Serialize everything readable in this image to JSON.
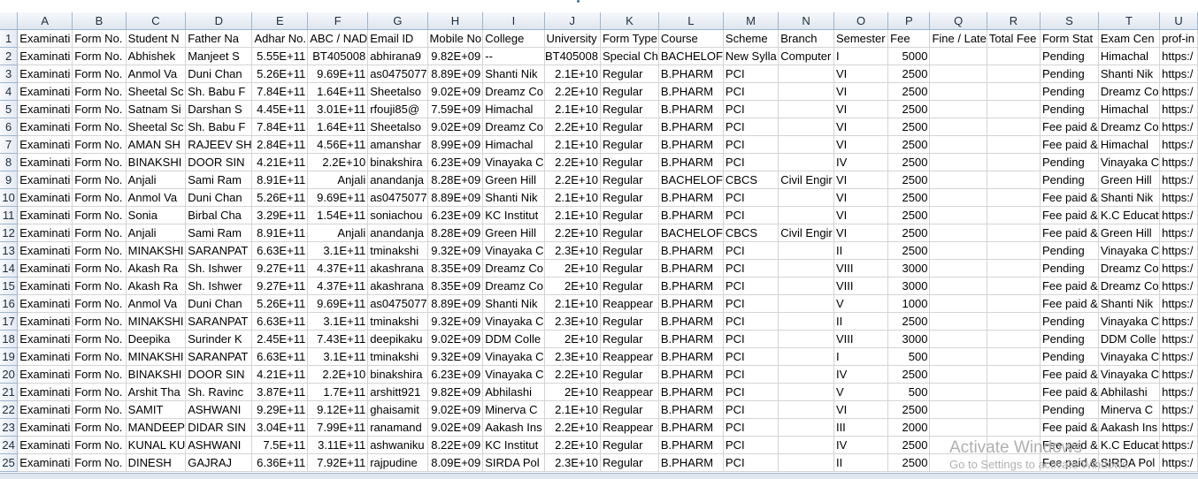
{
  "columns": [
    "A",
    "B",
    "C",
    "D",
    "E",
    "F",
    "G",
    "H",
    "I",
    "J",
    "K",
    "L",
    "M",
    "N",
    "O",
    "P",
    "Q",
    "R",
    "S",
    "T",
    "U"
  ],
  "numeric_columns": [
    4,
    5,
    7,
    9,
    15
  ],
  "rows": [
    [
      "Examinati",
      "Form No.",
      "Student N",
      "Father Na",
      "Adhar No.",
      "ABC / NAD",
      "Email ID",
      "Mobile No",
      "College",
      "University",
      "Form Type",
      "Course",
      "Scheme",
      "Branch",
      "Semester",
      "Fee",
      "Fine / Late",
      "Total Fee",
      "Form Stat",
      "Exam Cen",
      "prof-in"
    ],
    [
      "Examinati",
      "Form No.",
      "Abhishek",
      "Manjeet S",
      "5.55E+11",
      "BT405008",
      "abhirana9",
      "9.82E+09",
      "--",
      "BT405008",
      "Special Ch",
      "BACHELOF",
      "New Sylla",
      "Computer",
      "I",
      "5000",
      "",
      "",
      "Pending",
      "Himachal",
      "https:/"
    ],
    [
      "Examinati",
      "Form No.",
      "Anmol Va",
      "Duni Chan",
      "5.26E+11",
      "9.69E+11",
      "as0475077",
      "8.89E+09",
      "Shanti Nik",
      "2.1E+10",
      "Regular",
      "B.PHARM",
      "PCI",
      "",
      "VI",
      "2500",
      "",
      "",
      "Pending",
      "Shanti Nik",
      "https:/"
    ],
    [
      "Examinati",
      "Form No.",
      "Sheetal Sc",
      "Sh. Babu F",
      "7.84E+11",
      "1.64E+11",
      "Sheetalso",
      "9.02E+09",
      "Dreamz Co",
      "2.2E+10",
      "Regular",
      "B.PHARM",
      "PCI",
      "",
      "VI",
      "2500",
      "",
      "",
      "Pending",
      "Dreamz Co",
      "https:/"
    ],
    [
      "Examinati",
      "Form No.",
      "Satnam Si",
      "Darshan S",
      "4.45E+11",
      "3.01E+11",
      "rfouji85@",
      "7.59E+09",
      "Himachal",
      "2.1E+10",
      "Regular",
      "B.PHARM",
      "PCI",
      "",
      "VI",
      "2500",
      "",
      "",
      "Pending",
      "Himachal",
      "https:/"
    ],
    [
      "Examinati",
      "Form No.",
      "Sheetal Sc",
      "Sh. Babu F",
      "7.84E+11",
      "1.64E+11",
      "Sheetalso",
      "9.02E+09",
      "Dreamz Co",
      "2.2E+10",
      "Regular",
      "B.PHARM",
      "PCI",
      "",
      "VI",
      "2500",
      "",
      "",
      "Fee paid &",
      "Dreamz Co",
      "https:/"
    ],
    [
      "Examinati",
      "Form No.",
      "AMAN SH",
      "RAJEEV SH",
      "2.84E+11",
      "4.56E+11",
      "amanshar",
      "8.99E+09",
      "Himachal",
      "2.1E+10",
      "Regular",
      "B.PHARM",
      "PCI",
      "",
      "VI",
      "2500",
      "",
      "",
      "Fee paid &",
      "Himachal",
      "https:/"
    ],
    [
      "Examinati",
      "Form No.",
      "BINAKSHI",
      "DOOR SIN",
      "4.21E+11",
      "2.2E+10",
      "binakshira",
      "6.23E+09",
      "Vinayaka C",
      "2.2E+10",
      "Regular",
      "B.PHARM",
      "PCI",
      "",
      "IV",
      "2500",
      "",
      "",
      "Pending",
      "Vinayaka C",
      "https:/"
    ],
    [
      "Examinati",
      "Form No.",
      "Anjali",
      "Sami Ram",
      "8.91E+11",
      "Anjali",
      "anandanja",
      "8.28E+09",
      "Green Hill",
      "2.2E+10",
      "Regular",
      "BACHELOF",
      "CBCS",
      "Civil Engir",
      "VI",
      "2500",
      "",
      "",
      "Pending",
      "Green Hill",
      "https:/"
    ],
    [
      "Examinati",
      "Form No.",
      "Anmol Va",
      "Duni Chan",
      "5.26E+11",
      "9.69E+11",
      "as0475077",
      "8.89E+09",
      "Shanti Nik",
      "2.1E+10",
      "Regular",
      "B.PHARM",
      "PCI",
      "",
      "VI",
      "2500",
      "",
      "",
      "Fee paid &",
      "Shanti Nik",
      "https:/"
    ],
    [
      "Examinati",
      "Form No.",
      "Sonia",
      "Birbal Cha",
      "3.29E+11",
      "1.54E+11",
      "soniachou",
      "6.23E+09",
      "KC Institut",
      "2.1E+10",
      "Regular",
      "B.PHARM",
      "PCI",
      "",
      "VI",
      "2500",
      "",
      "",
      "Fee paid &",
      "K.C Educat",
      "https:/"
    ],
    [
      "Examinati",
      "Form No.",
      "Anjali",
      "Sami Ram",
      "8.91E+11",
      "Anjali",
      "anandanja",
      "8.28E+09",
      "Green Hill",
      "2.2E+10",
      "Regular",
      "BACHELOF",
      "CBCS",
      "Civil Engir",
      "VI",
      "2500",
      "",
      "",
      "Fee paid &",
      "Green Hill",
      "https:/"
    ],
    [
      "Examinati",
      "Form No.",
      "MINAKSHI",
      "SARANPAT",
      "6.63E+11",
      "3.1E+11",
      "tminakshi",
      "9.32E+09",
      "Vinayaka C",
      "2.3E+10",
      "Regular",
      "B.PHARM",
      "PCI",
      "",
      "II",
      "2500",
      "",
      "",
      "Pending",
      "Vinayaka C",
      "https:/"
    ],
    [
      "Examinati",
      "Form No.",
      "Akash Ra",
      "Sh. Ishwer",
      "9.27E+11",
      "4.37E+11",
      "akashrana",
      "8.35E+09",
      "Dreamz Co",
      "2E+10",
      "Regular",
      "B.PHARM",
      "PCI",
      "",
      "VIII",
      "3000",
      "",
      "",
      "Pending",
      "Dreamz Co",
      "https:/"
    ],
    [
      "Examinati",
      "Form No.",
      "Akash Ra",
      "Sh. Ishwer",
      "9.27E+11",
      "4.37E+11",
      "akashrana",
      "8.35E+09",
      "Dreamz Co",
      "2E+10",
      "Regular",
      "B.PHARM",
      "PCI",
      "",
      "VIII",
      "3000",
      "",
      "",
      "Fee paid &",
      "Dreamz Co",
      "https:/"
    ],
    [
      "Examinati",
      "Form No.",
      "Anmol Va",
      "Duni Chan",
      "5.26E+11",
      "9.69E+11",
      "as0475077",
      "8.89E+09",
      "Shanti Nik",
      "2.1E+10",
      "Reappear",
      "B.PHARM",
      "PCI",
      "",
      "V",
      "1000",
      "",
      "",
      "Fee paid &",
      "Shanti Nik",
      "https:/"
    ],
    [
      "Examinati",
      "Form No.",
      "MINAKSHI",
      "SARANPAT",
      "6.63E+11",
      "3.1E+11",
      "tminakshi",
      "9.32E+09",
      "Vinayaka C",
      "2.3E+10",
      "Regular",
      "B.PHARM",
      "PCI",
      "",
      "II",
      "2500",
      "",
      "",
      "Pending",
      "Vinayaka C",
      "https:/"
    ],
    [
      "Examinati",
      "Form No.",
      "Deepika",
      "Surinder K",
      "2.45E+11",
      "7.43E+11",
      "deepikaku",
      "9.02E+09",
      "DDM Colle",
      "2E+10",
      "Regular",
      "B.PHARM",
      "PCI",
      "",
      "VIII",
      "3000",
      "",
      "",
      "Pending",
      "DDM Colle",
      "https:/"
    ],
    [
      "Examinati",
      "Form No.",
      "MINAKSHI",
      "SARANPAT",
      "6.63E+11",
      "3.1E+11",
      "tminakshi",
      "9.32E+09",
      "Vinayaka C",
      "2.3E+10",
      "Reappear",
      "B.PHARM",
      "PCI",
      "",
      "I",
      "500",
      "",
      "",
      "Pending",
      "Vinayaka C",
      "https:/"
    ],
    [
      "Examinati",
      "Form No.",
      "BINAKSHI",
      "DOOR SIN",
      "4.21E+11",
      "2.2E+10",
      "binakshira",
      "6.23E+09",
      "Vinayaka C",
      "2.2E+10",
      "Regular",
      "B.PHARM",
      "PCI",
      "",
      "IV",
      "2500",
      "",
      "",
      "Fee paid &",
      "Vinayaka C",
      "https:/"
    ],
    [
      "Examinati",
      "Form No.",
      "Arshit Tha",
      "Sh. Ravinc",
      "3.87E+11",
      "1.7E+11",
      "arshitt921",
      "9.82E+09",
      "Abhilashi",
      "2E+10",
      "Reappear",
      "B.PHARM",
      "PCI",
      "",
      "V",
      "500",
      "",
      "",
      "Fee paid &",
      "Abhilashi",
      "https:/"
    ],
    [
      "Examinati",
      "Form No.",
      "SAMIT",
      "ASHWANI",
      "9.29E+11",
      "9.12E+11",
      "ghaisamit",
      "9.02E+09",
      "Minerva C",
      "2.1E+10",
      "Regular",
      "B.PHARM",
      "PCI",
      "",
      "VI",
      "2500",
      "",
      "",
      "Pending",
      "Minerva C",
      "https:/"
    ],
    [
      "Examinati",
      "Form No.",
      "MANDEEP",
      "DIDAR SIN",
      "3.04E+11",
      "7.99E+11",
      "ranamand",
      "9.02E+09",
      "Aakash Ins",
      "2.2E+10",
      "Reappear",
      "B.PHARM",
      "PCI",
      "",
      "III",
      "2000",
      "",
      "",
      "Fee paid &",
      "Aakash Ins",
      "https:/"
    ],
    [
      "Examinati",
      "Form No.",
      "KUNAL KU",
      "ASHWANI",
      "7.5E+11",
      "3.11E+11",
      "ashwaniku",
      "8.22E+09",
      "KC Institut",
      "2.2E+10",
      "Regular",
      "B.PHARM",
      "PCI",
      "",
      "IV",
      "2500",
      "",
      "",
      "Fee paid &",
      "K.C Educat",
      "https:/"
    ],
    [
      "Examinati",
      "Form No.",
      "DINESH",
      "GAJRAJ",
      "6.36E+11",
      "7.92E+11",
      "rajpudine",
      "8.09E+09",
      "SIRDA Pol",
      "2.3E+10",
      "Regular",
      "B.PHARM",
      "PCI",
      "",
      "II",
      "2500",
      "",
      "",
      "Fee paid &",
      "SIRDA Pol",
      "https:/"
    ]
  ],
  "watermark": {
    "title": "Activate Windows",
    "subtitle": "Go to Settings to activate Windows."
  }
}
